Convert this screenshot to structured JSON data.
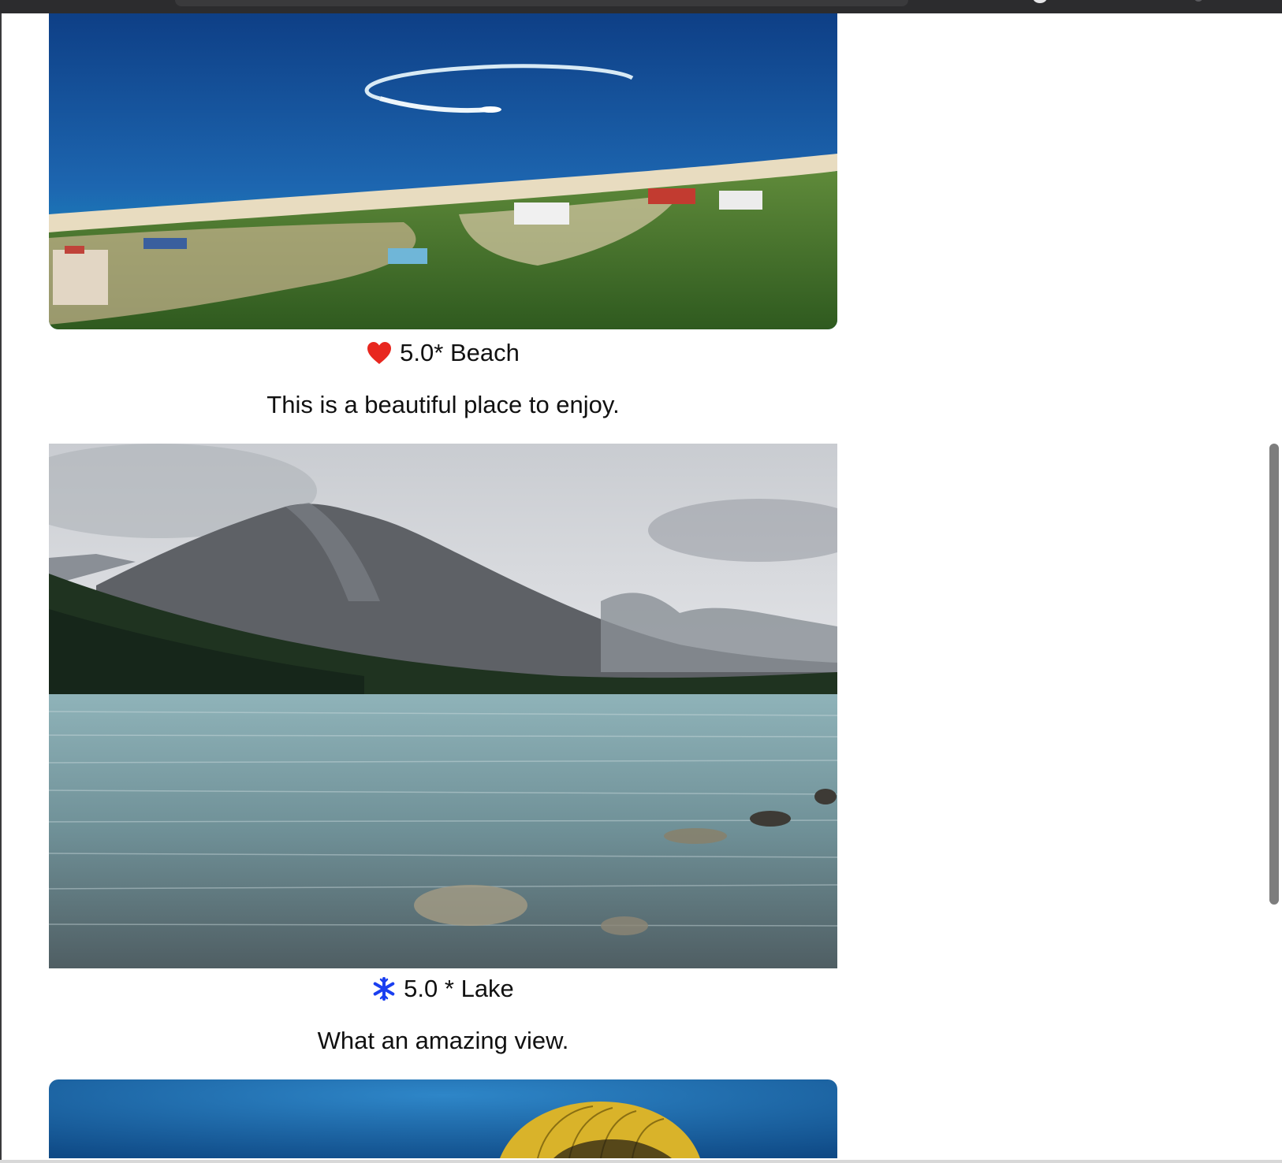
{
  "cards": [
    {
      "rating": "5.0*",
      "name": "Beach",
      "icon": "heart-icon",
      "icon_color": "#e8271f",
      "description": "This is a beautiful place to enjoy."
    },
    {
      "rating": "5.0 *",
      "name": "Lake",
      "icon": "snowflake-icon",
      "icon_color": "#1a3ff0",
      "description": "What an amazing view."
    }
  ]
}
